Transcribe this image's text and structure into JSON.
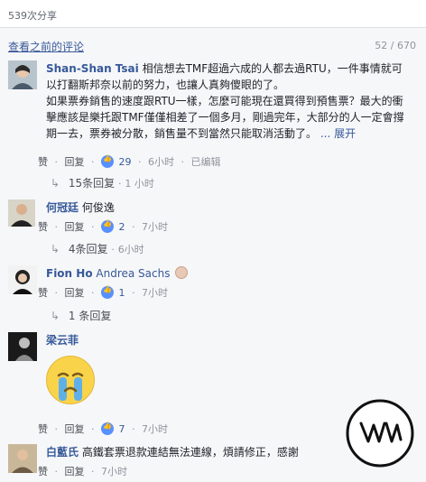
{
  "header": {
    "share_count": "539次分享"
  },
  "prev": {
    "link": "查看之前的评论",
    "counter": "52 / 670"
  },
  "comments": [
    {
      "name": "Shan-Shan Tsai",
      "text1": "相信想去TMF超過六成的人都去過RTU，一件事情就可以打翻斯邦奈以前的努力，也讓人真夠傻眼的了。",
      "text2": "如果票券銷售的速度跟RTU一樣，怎麼可能現在還買得到預售票？最大的衝擊應該是樂托跟TMF僅僅相差了一個多月，剛過完年，大部分的人一定會撐期一去，票券被分散，銷售量不到當然只能取消活動了。",
      "more": "... 展开",
      "like": "赞",
      "reply": "回复",
      "likes": "29",
      "time": "6小时",
      "edited": "已编辑",
      "replies": "15条回复",
      "reply_time": "1 小时"
    },
    {
      "name": "何冠廷",
      "text": "何俊逸",
      "like": "赞",
      "reply": "回复",
      "likes": "2",
      "time": "7小时",
      "replies": "4条回复",
      "reply_time": "6小时"
    },
    {
      "name": "Fion Ho",
      "tag": "Andrea Sachs",
      "like": "赞",
      "reply": "回复",
      "likes": "1",
      "time": "7小时",
      "replies": "1 条回复"
    },
    {
      "name": "梁云菲",
      "like": "赞",
      "reply": "回复",
      "likes": "7",
      "time": "7小时"
    },
    {
      "name": "白藍氏",
      "text": "高鐵套票退款連結無法連線，煩請修正，感謝",
      "like": "赞",
      "reply": "回复",
      "time": "7小时"
    }
  ],
  "colors": {
    "link": "#365899",
    "like": "#5890ff",
    "meta": "#90949c",
    "bg": "#f6f7f9"
  }
}
